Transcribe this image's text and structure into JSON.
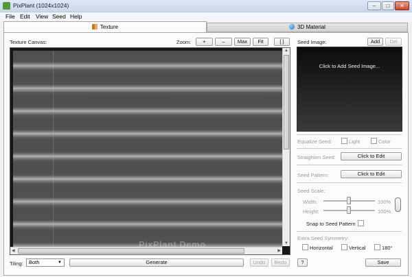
{
  "window": {
    "title": "PixPlant (1024x1024)",
    "minimize": "–",
    "maximize": "□",
    "close": "✕"
  },
  "menu": [
    "File",
    "Edit",
    "View",
    "Seed",
    "Help"
  ],
  "tabs": {
    "texture": "Texture",
    "material": "3D Material"
  },
  "canvas": {
    "label": "Texture Canvas:",
    "zoom_label": "Zoom:",
    "zoom_in": "+",
    "zoom_out": "–",
    "zoom_max": "Max",
    "zoom_fit": "Fit",
    "zoom_bracket": "[ ]",
    "watermark": "PixPlant Demo"
  },
  "bottom": {
    "tiling_label": "Tiling:",
    "tiling_value": "Both",
    "generate": "Generate",
    "undo": "Undo",
    "redo": "Redo"
  },
  "seed": {
    "label": "Seed Image:",
    "add": "Add",
    "del": "Del",
    "preview_text": "Click to Add Seed Image...",
    "equalize_label": "Equalize Seed:",
    "equalize_light": "Light",
    "equalize_color": "Color",
    "straighten_label": "Straighten Seed:",
    "straighten_button": "Click to Edit",
    "pattern_label": "Seed Pattern:",
    "pattern_button": "Click to Edit",
    "scale_label": "Seed Scale:",
    "width_label": "Width:",
    "width_value": "100%",
    "height_label": "Height:",
    "height_value": "100%",
    "snap_label": "Snap to Seed Pattern",
    "symmetry_label": "Extra Seed Symmetry:",
    "sym_horizontal": "Horizontal",
    "sym_vertical": "Vertical",
    "sym_180": "180°",
    "help": "?",
    "save": "Save"
  }
}
